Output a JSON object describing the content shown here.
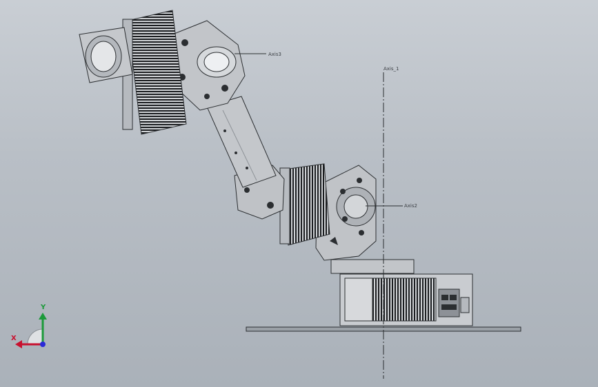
{
  "viewport": {
    "axis_labels": {
      "axis1": "Axis_1",
      "axis2": "Axis2",
      "axis3": "Axis3"
    },
    "triad": {
      "x_label": "X",
      "y_label": "Y",
      "x_color": "#c8102e",
      "y_color": "#1c9a3a",
      "z_color": "#2a2ad8"
    }
  }
}
